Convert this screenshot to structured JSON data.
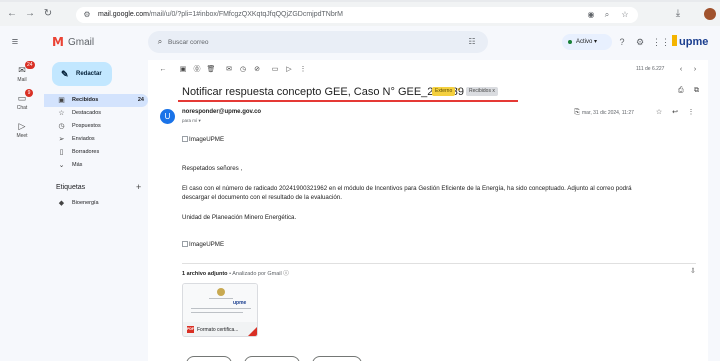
{
  "browser": {
    "url_host": "mail.google.com",
    "url_path": "/mail/u/0/?pli=1#inbox/FMfcgzQXKqtqJfqQQjZGDcmjpdTNbrM",
    "icons": [
      "back-icon",
      "forward-icon",
      "reload-icon",
      "site-info-icon",
      "lens-icon",
      "zoom-icon",
      "bookmark-star-icon",
      "download-icon",
      "profile-icon"
    ]
  },
  "gmail": {
    "app_name": "Gmail",
    "search_placeholder": "Buscar correo",
    "status_label": "Activo",
    "org_logo": "upme"
  },
  "rail": [
    {
      "label": "Mail",
      "badge": "24",
      "icon": "mail-icon"
    },
    {
      "label": "Chat",
      "badge": "9",
      "icon": "chat-icon"
    },
    {
      "label": "Meet",
      "badge": "",
      "icon": "meet-icon"
    }
  ],
  "nav": {
    "compose_label": "Redactar",
    "items": [
      {
        "label": "Recibidos",
        "count": "24",
        "icon": "inbox-icon",
        "active": true
      },
      {
        "label": "Destacados",
        "count": "",
        "icon": "star-icon",
        "active": false
      },
      {
        "label": "Pospuestos",
        "count": "",
        "icon": "clock-icon",
        "active": false
      },
      {
        "label": "Enviados",
        "count": "",
        "icon": "send-icon",
        "active": false
      },
      {
        "label": "Borradores",
        "count": "",
        "icon": "draft-icon",
        "active": false
      },
      {
        "label": "Más",
        "count": "",
        "icon": "chevron-down-icon",
        "active": false
      }
    ],
    "labels_title": "Etiquetas",
    "labels": [
      {
        "label": "Bioenergía",
        "color": "#202124"
      }
    ]
  },
  "message": {
    "pager": "111 de 6.227",
    "subject": "Notificar respuesta concepto GEE, Caso N° GEE_202439",
    "tag_external": "Externo",
    "tag_inbox": "Recibidos x",
    "sender_initial": "U",
    "sender": "noresponder@upme.gov.co",
    "to": "para mí",
    "date": "mar, 31 dic 2024, 11:27",
    "image_alt_1": "ImageUPME",
    "greeting": "Respetados señores ,",
    "body_1": "El caso con el número de radicado 20241900321962 en el módulo de Incentivos para Gestión Eficiente de la Energía, ha sido conceptuado. Adjunto al correo podrá",
    "body_2": "descargar el documento con el resultado de la evaluación.",
    "signature": "Unidad de Planeación Minero Energética.",
    "image_alt_2": "ImageUPME",
    "attachments_count": "1 archivo adjunto",
    "attachments_scan": " • Analizado por Gmail",
    "attachment_name": "Formato certifica..."
  },
  "colors": {
    "accent": "#1a73e8",
    "subject_underline": "#e53935",
    "external_tag": "#f4d03f",
    "compose": "#c2e7ff",
    "active_nav": "#d3e3fd"
  }
}
